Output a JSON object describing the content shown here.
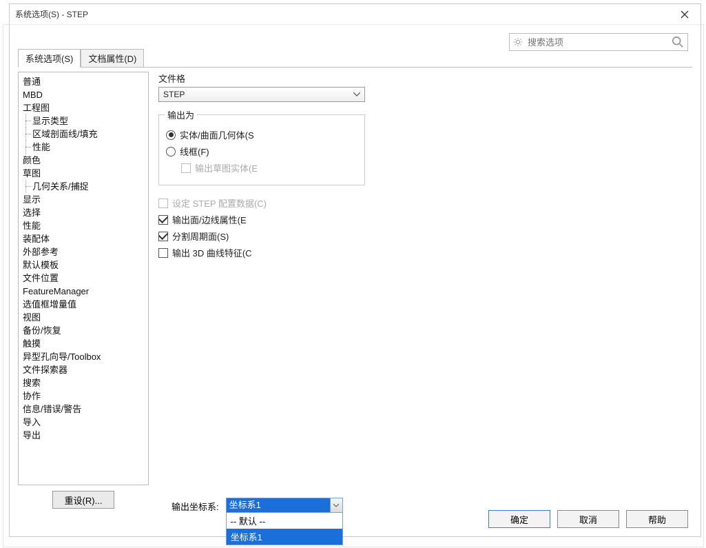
{
  "title": "系统选项(S) - STEP",
  "search": {
    "placeholder": "搜索选项"
  },
  "tabs": {
    "system": "系统选项(S)",
    "doc": "文档属性(D)"
  },
  "tree": {
    "items": [
      "普通",
      "MBD",
      "工程图",
      "显示类型",
      "区域剖面线/填充",
      "性能",
      "颜色",
      "草图",
      "几何关系/捕捉",
      "显示",
      "选择",
      "性能",
      "装配体",
      "外部参考",
      "默认模板",
      "文件位置",
      "FeatureManager",
      "选值框增量值",
      "视图",
      "备份/恢复",
      "触摸",
      "异型孔向导/Toolbox",
      "文件探索器",
      "搜索",
      "协作",
      "信息/错误/警告",
      "导入",
      "导出"
    ],
    "children": {
      "2": [
        3,
        4,
        5
      ],
      "7": [
        8
      ]
    }
  },
  "reset_label": "重设(R)...",
  "content": {
    "fileformat_label": "文件格",
    "fileformat_value": "STEP",
    "output_group": "输出为",
    "radio_solid": "实体/曲面几何体(S",
    "radio_wire": "线框(F)",
    "chk_sketch": "输出草图实体(E",
    "chk_stepcfg": "设定 STEP 配置数据(C)",
    "chk_face": "输出面/边线属性(E",
    "chk_split": "分割周期面(S)",
    "chk_3d": "输出 3D 曲线特征(C"
  },
  "coord": {
    "label": "输出坐标系:",
    "selected": "坐标系1",
    "options": [
      "-- 默认 --",
      "坐标系1"
    ]
  },
  "footer": {
    "ok": "确定",
    "cancel": "取消",
    "help": "帮助"
  }
}
